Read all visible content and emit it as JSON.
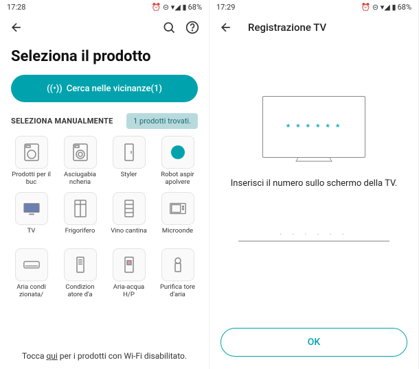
{
  "colors": {
    "accent": "#00a3ad"
  },
  "left": {
    "status": {
      "time": "17:28",
      "battery": "68%"
    },
    "title": "Seleziona il prodotto",
    "search_nearby": "Cerca nelle vicinanze(1)",
    "section_label": "SELEZIONA MANUALMENTE",
    "badge": "1 prodotti trovati.",
    "products": [
      {
        "icon": "washer-icon",
        "label": "Prodotti per il buc"
      },
      {
        "icon": "dryer-icon",
        "label": "Asciugabia ncheria"
      },
      {
        "icon": "styler-icon",
        "label": "Styler"
      },
      {
        "icon": "robot-icon",
        "label": "Robot aspir apolvere"
      },
      {
        "icon": "tv-icon",
        "label": "TV"
      },
      {
        "icon": "fridge-icon",
        "label": "Frigorifero"
      },
      {
        "icon": "wine-icon",
        "label": "Vino cantina"
      },
      {
        "icon": "microwave-icon",
        "label": "Microonde"
      },
      {
        "icon": "ac-icon",
        "label": "Aria condi zionata/"
      },
      {
        "icon": "cond-icon",
        "label": "Condizion atore d'a"
      },
      {
        "icon": "water-icon",
        "label": "Aria-acqua H/P"
      },
      {
        "icon": "purifier-icon",
        "label": "Purifica tore d'aria"
      }
    ],
    "footer_pre": "Tocca ",
    "footer_link": "qui",
    "footer_post": " per i prodotti con Wi-Fi disabilitato."
  },
  "right": {
    "status": {
      "time": "17:29",
      "battery": "68%"
    },
    "title": "Registrazione TV",
    "tv_stars": "* * * * * *",
    "instruction": "Inserisci il numero sullo schermo della TV.",
    "code_placeholder": ". . . . . .",
    "ok_label": "OK"
  }
}
